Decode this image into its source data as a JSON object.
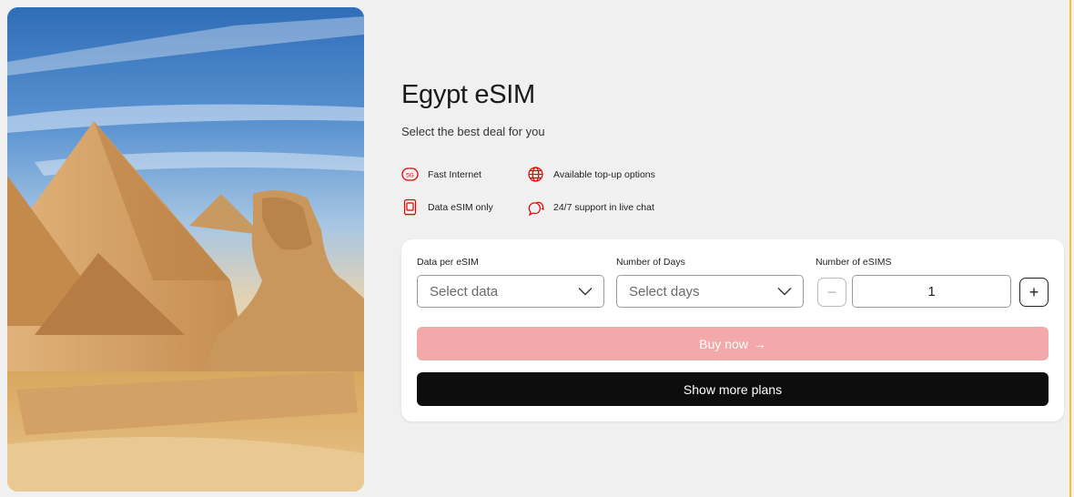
{
  "product": {
    "title": "Egypt eSIM",
    "subtitle": "Select the best deal for you"
  },
  "features": [
    {
      "icon": "5g-icon",
      "badge": "5G",
      "label": "Fast Internet"
    },
    {
      "icon": "globe-icon",
      "label": "Available top-up options"
    },
    {
      "icon": "sim-card-icon",
      "label": "Data eSIM only"
    },
    {
      "icon": "chat-bubbles-icon",
      "label": "24/7 support in live chat"
    }
  ],
  "form": {
    "data_label": "Data per eSIM",
    "data_placeholder": "Select data",
    "days_label": "Number of Days",
    "days_placeholder": "Select days",
    "count_label": "Number of eSIMS",
    "count_value": "1",
    "minus_symbol": "−",
    "plus_symbol": "+",
    "buy_label": "Buy now",
    "buy_arrow": "→",
    "more_label": "Show more plans"
  },
  "colors": {
    "accent": "#e60000",
    "buy_disabled": "#f3a9a9",
    "dark_button": "#0d0d0d",
    "edge": "#f3c428"
  }
}
